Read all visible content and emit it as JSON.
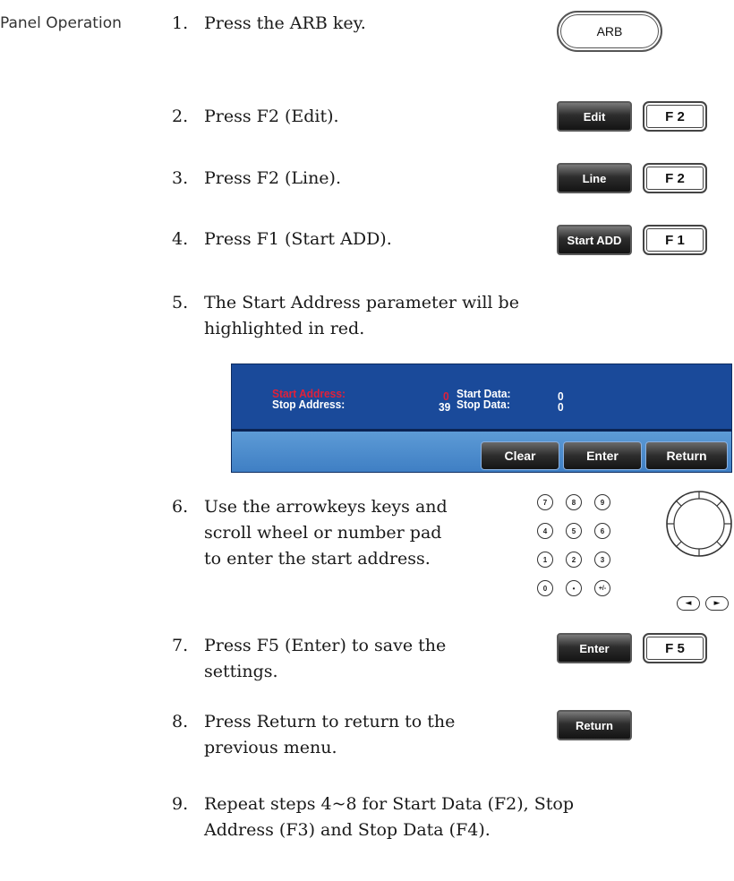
{
  "section_label": "Panel Operation",
  "steps": [
    {
      "num": "1.",
      "lines": [
        "Press the ARB key."
      ]
    },
    {
      "num": "2.",
      "lines": [
        "Press F2 (Edit)."
      ]
    },
    {
      "num": "3.",
      "lines": [
        "Press F2 (Line)."
      ]
    },
    {
      "num": "4.",
      "lines": [
        "Press F1 (Start ADD)."
      ]
    },
    {
      "num": "5.",
      "lines": [
        "The Start Address parameter will be",
        "highlighted in red."
      ]
    },
    {
      "num": "6.",
      "lines": [
        "Use the arrowkeys keys and",
        "scroll wheel or number pad",
        "to enter the start address."
      ]
    },
    {
      "num": "7.",
      "lines": [
        "Press F5 (Enter) to save the",
        "settings."
      ]
    },
    {
      "num": "8.",
      "lines": [
        "Press Return to return to the",
        "previous menu."
      ]
    },
    {
      "num": "9.",
      "lines": [
        "Repeat steps 4~8 for Start Data (F2), Stop",
        "Address (F3) and Stop Data (F4)."
      ]
    }
  ],
  "keys": {
    "arb": "ARB",
    "edit_soft": "Edit",
    "edit_f": "F 2",
    "line_soft": "Line",
    "line_f": "F 2",
    "startadd_soft": "Start ADD",
    "startadd_f": "F 1",
    "enter_soft": "Enter",
    "enter_f": "F 5",
    "return_soft": "Return"
  },
  "screen": {
    "start_address_label": "Start Address:",
    "start_address_value": "0",
    "stop_address_label": "Stop Address:",
    "stop_address_value": "39",
    "start_data_label": "Start Data:",
    "start_data_value": "0",
    "stop_data_label": "Stop Data:",
    "stop_data_value": "0",
    "buttons": [
      "Clear",
      "Enter",
      "Return"
    ],
    "highlight_color": "#e0203a"
  },
  "keypad": {
    "rows": [
      [
        "7",
        "8",
        "9"
      ],
      [
        "4",
        "5",
        "6"
      ],
      [
        "1",
        "2",
        "3"
      ],
      [
        "0",
        "•",
        "+/-"
      ]
    ],
    "left_arrow": "◄",
    "right_arrow": "►"
  }
}
